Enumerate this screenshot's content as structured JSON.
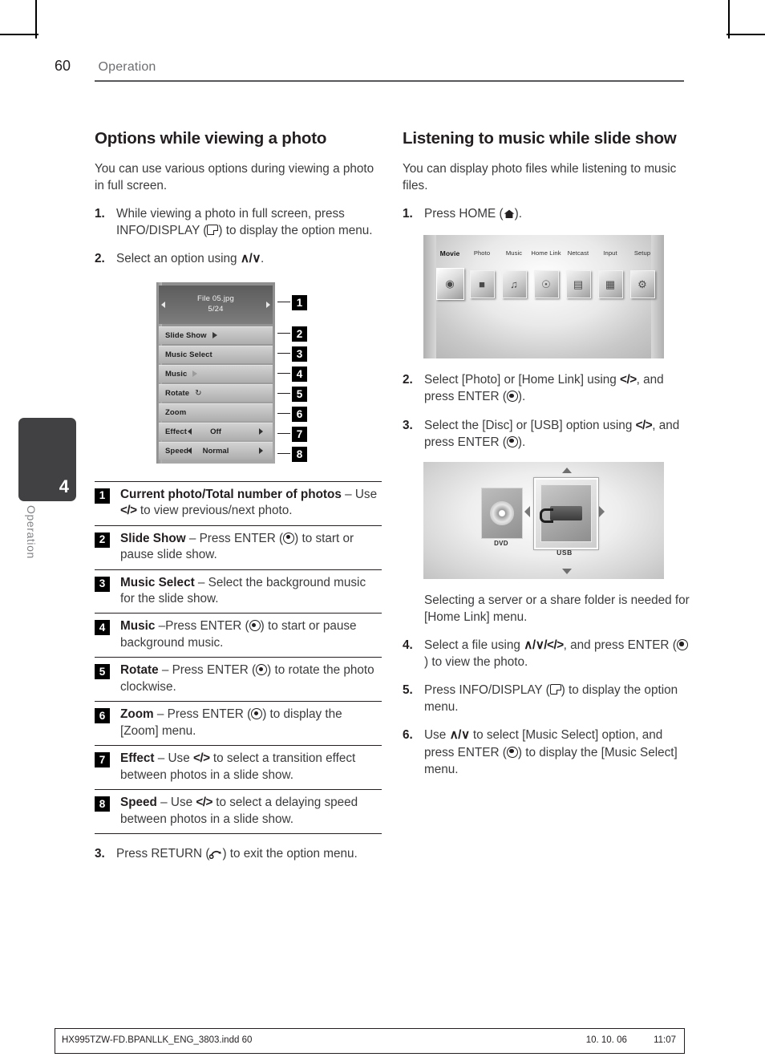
{
  "header": {
    "page_number": "60",
    "section": "Operation"
  },
  "sidebar": {
    "chapter_number": "4",
    "chapter_label": "Operation"
  },
  "left_column": {
    "title": "Options while viewing a photo",
    "intro": "You can use various options during viewing a photo in full screen.",
    "steps": [
      {
        "num": "1.",
        "text_before": "While viewing a photo in full screen, press INFO/DISPLAY (",
        "text_after": ") to display the option menu.",
        "icon": "info-display-icon"
      },
      {
        "num": "2.",
        "text_before": "Select an option using ",
        "symbol": "∧/∨",
        "text_after": "."
      }
    ],
    "final_step": {
      "num": "3.",
      "text_before": "Press RETURN (",
      "text_after": ") to exit the option menu.",
      "icon": "return-icon"
    },
    "osd": {
      "file_name": "File 05.jpg",
      "file_counter": "5/24",
      "rows": [
        {
          "label": "Slide Show",
          "marker": "play-arrow-icon"
        },
        {
          "label": "Music Select",
          "marker": ""
        },
        {
          "label": "Music",
          "marker": "play-arrow-dim-icon"
        },
        {
          "label": "Rotate",
          "marker": "rotate-icon"
        },
        {
          "label": "Zoom",
          "marker": ""
        },
        {
          "label": "Effect",
          "value": "Off",
          "marker": "left-right-arrows"
        },
        {
          "label": "Speed",
          "value": "Normal",
          "marker": "left-right-arrows"
        }
      ]
    },
    "legend": [
      {
        "badge": "1",
        "term": "Current photo/Total number of photos",
        "desc_pre": " – Use ",
        "symbol": "</>",
        "desc_post": " to view previous/next photo."
      },
      {
        "badge": "2",
        "term": "Slide Show",
        "desc_pre": " – Press ENTER (",
        "icon": "enter-icon",
        "desc_post": ") to start or pause slide show."
      },
      {
        "badge": "3",
        "term": "Music Select",
        "desc_pre": " – Select the background music for the slide show.",
        "desc_post": ""
      },
      {
        "badge": "4",
        "term": "Music",
        "desc_pre": " –Press ENTER (",
        "icon": "enter-icon",
        "desc_post": ") to start or pause background music."
      },
      {
        "badge": "5",
        "term": "Rotate",
        "desc_pre": " – Press ENTER (",
        "icon": "enter-icon",
        "desc_post": ") to rotate the photo clockwise."
      },
      {
        "badge": "6",
        "term": "Zoom",
        "desc_pre": " – Press ENTER (",
        "icon": "enter-icon",
        "desc_post": ") to display the [Zoom] menu."
      },
      {
        "badge": "7",
        "term": "Effect",
        "desc_pre": " – Use ",
        "symbol": "</>",
        "desc_post": " to select a transition effect between photos in a slide show."
      },
      {
        "badge": "8",
        "term": "Speed",
        "desc_pre": " – Use ",
        "symbol": "</>",
        "desc_post": " to select a delaying speed between photos in a slide show."
      }
    ]
  },
  "right_column": {
    "title": "Listening to music while slide show",
    "intro": "You can display photo files while listening to music files.",
    "step1": {
      "num": "1.",
      "text_before": "Press HOME (",
      "text_after": ").",
      "icon": "home-icon"
    },
    "home_menu": {
      "items": [
        "Movie",
        "Photo",
        "Music",
        "Home Link",
        "Netcast",
        "Input",
        "Setup"
      ],
      "selected": "Movie",
      "icons": [
        "film-reel-icon",
        "photo-icon",
        "music-note-icon",
        "home-link-icon",
        "netcast-icon",
        "input-icon",
        "gear-icon"
      ]
    },
    "step2": {
      "num": "2.",
      "a": "Select [Photo] or [Home Link] using ",
      "sym": "</>",
      "b": ", and press ENTER (",
      "c": ")."
    },
    "step3": {
      "num": "3.",
      "a": "Select the [Disc] or [USB] option using ",
      "sym": "</>",
      "b": ", and press ENTER (",
      "c": ")."
    },
    "source_menu": {
      "items": [
        "DVD",
        "USB"
      ],
      "selected": "USB"
    },
    "note": "Selecting a server or a share folder is needed for [Home Link] menu.",
    "step4": {
      "num": "4.",
      "a": "Select a file using ",
      "sym": "∧/∨/</>",
      "b": ", and press ENTER (",
      "c": ") to view the photo."
    },
    "step5": {
      "num": "5.",
      "a": "Press INFO/DISPLAY (",
      "b": ") to display the option menu."
    },
    "step6": {
      "num": "6.",
      "a": "Use ",
      "sym": "∧/∨",
      "b": " to select [Music Select] option, and press ENTER (",
      "c": ") to display the [Music Select] menu."
    }
  },
  "footer": {
    "file_name": "HX995TZW-FD.BPANLLK_ENG_3803.indd   60",
    "date": "10. 10. 06",
    "time": "11:07"
  }
}
